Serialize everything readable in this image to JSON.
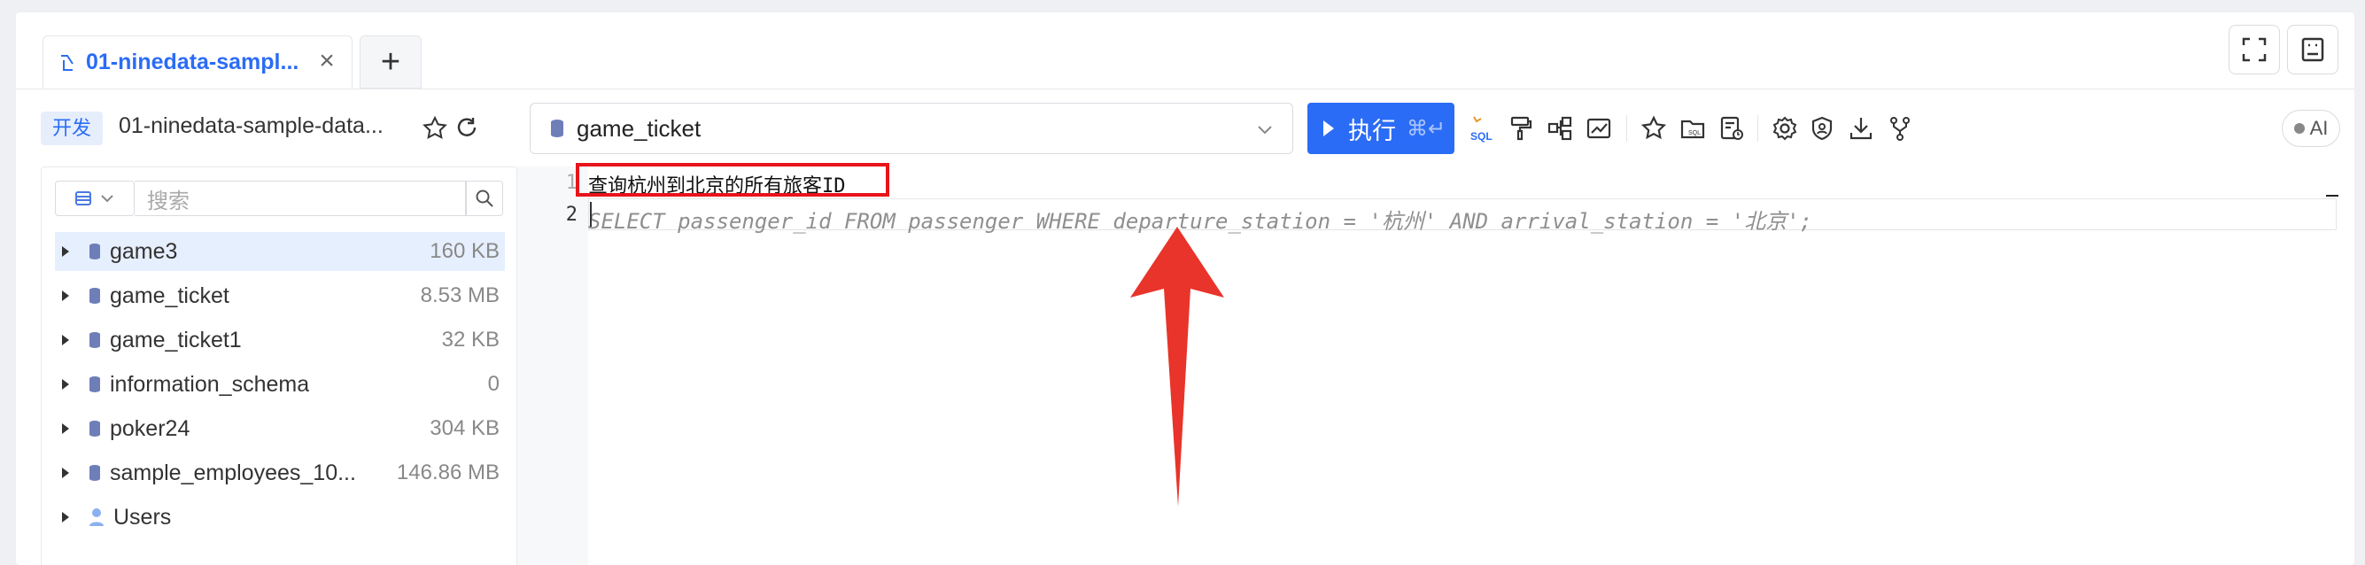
{
  "tabs": [
    {
      "label": "01-ninedata-sampl..."
    }
  ],
  "tab_add_label": "+",
  "tab_close_label": "×",
  "env_badge": "开发",
  "connection_name": "01-ninedata-sample-data...",
  "database_select": {
    "value": "game_ticket"
  },
  "run_button": {
    "label": "执行",
    "shortcut": "⌘↵"
  },
  "ai_label": "AI",
  "search": {
    "placeholder": "搜索"
  },
  "tree": [
    {
      "name": "game3",
      "size": "160 KB",
      "selected": true
    },
    {
      "name": "game_ticket",
      "size": "8.53 MB"
    },
    {
      "name": "game_ticket1",
      "size": "32 KB"
    },
    {
      "name": "information_schema",
      "size": "0"
    },
    {
      "name": "poker24",
      "size": "304 KB"
    },
    {
      "name": "sample_employees_10...",
      "size": "146.86 MB"
    },
    {
      "name": "Users",
      "size": ""
    }
  ],
  "editor": {
    "line_numbers": [
      "1",
      "2"
    ],
    "line1": "查询杭州到北京的所有旅客ID",
    "line2": "SELECT passenger_id FROM passenger WHERE departure_station = '杭州' AND arrival_station = '北京';"
  },
  "colors": {
    "accent": "#2b6cf6",
    "highlight_box": "#e8141b",
    "arrow": "#e8342a"
  }
}
